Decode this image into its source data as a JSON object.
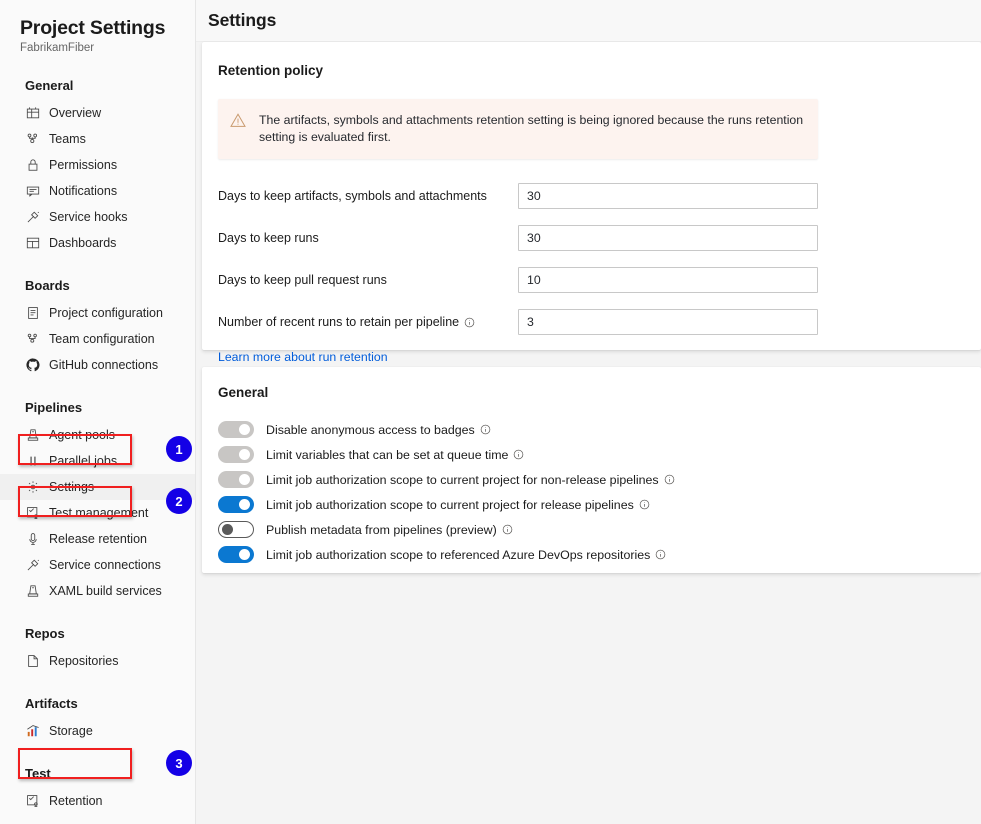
{
  "sidebar": {
    "title": "Project Settings",
    "subtitle": "FabrikamFiber",
    "groups": [
      {
        "header": "General",
        "items": [
          {
            "label": "Overview",
            "icon": "overview-icon"
          },
          {
            "label": "Teams",
            "icon": "teams-icon"
          },
          {
            "label": "Permissions",
            "icon": "lock-icon"
          },
          {
            "label": "Notifications",
            "icon": "notification-icon"
          },
          {
            "label": "Service hooks",
            "icon": "service-hooks-icon"
          },
          {
            "label": "Dashboards",
            "icon": "dashboards-icon"
          }
        ]
      },
      {
        "header": "Boards",
        "items": [
          {
            "label": "Project configuration",
            "icon": "project-config-icon"
          },
          {
            "label": "Team configuration",
            "icon": "team-config-icon"
          },
          {
            "label": "GitHub connections",
            "icon": "github-icon"
          }
        ]
      },
      {
        "header": "Pipelines",
        "items": [
          {
            "label": "Agent pools",
            "icon": "agent-pools-icon"
          },
          {
            "label": "Parallel jobs",
            "icon": "parallel-jobs-icon"
          },
          {
            "label": "Settings",
            "icon": "gear-icon",
            "selected": true,
            "highlighted": true,
            "badge": "1"
          },
          {
            "label": "Test management",
            "icon": "test-management-icon"
          },
          {
            "label": "Release retention",
            "icon": "release-retention-icon",
            "highlighted": true,
            "badge": "2"
          },
          {
            "label": "Service connections",
            "icon": "service-connections-icon"
          },
          {
            "label": "XAML build services",
            "icon": "xaml-build-icon"
          }
        ]
      },
      {
        "header": "Repos",
        "items": [
          {
            "label": "Repositories",
            "icon": "repositories-icon"
          }
        ]
      },
      {
        "header": "Artifacts",
        "items": [
          {
            "label": "Storage",
            "icon": "storage-icon"
          }
        ]
      },
      {
        "header": "Test",
        "items": [
          {
            "label": "Retention",
            "icon": "retention-icon",
            "highlighted": true,
            "badge": "3"
          }
        ]
      }
    ]
  },
  "header": {
    "title": "Settings"
  },
  "retention": {
    "card_title": "Retention policy",
    "warning": "The artifacts, symbols and attachments retention setting is being ignored because the runs retention setting is evaluated first.",
    "warning_icon": "warning-triangle-icon",
    "fields": [
      {
        "label": "Days to keep artifacts, symbols and attachments",
        "value": "30",
        "info": false
      },
      {
        "label": "Days to keep runs",
        "value": "30",
        "info": false
      },
      {
        "label": "Days to keep pull request runs",
        "value": "10",
        "info": false
      },
      {
        "label": "Number of recent runs to retain per pipeline",
        "value": "3",
        "info": true
      }
    ],
    "learn_more": "Learn more about run retention"
  },
  "general": {
    "card_title": "General",
    "toggles": [
      {
        "label": "Disable anonymous access to badges",
        "state": "off",
        "info": true
      },
      {
        "label": "Limit variables that can be set at queue time",
        "state": "off",
        "info": true
      },
      {
        "label": "Limit job authorization scope to current project for non-release pipelines",
        "state": "off",
        "info": true
      },
      {
        "label": "Limit job authorization scope to current project for release pipelines",
        "state": "on",
        "info": true
      },
      {
        "label": "Publish metadata from pipelines (preview)",
        "state": "offdark",
        "info": true
      },
      {
        "label": "Limit job authorization scope to referenced Azure DevOps repositories",
        "state": "on",
        "info": true
      }
    ]
  },
  "colors": {
    "accent": "#0b78d1",
    "badge": "#1400e6",
    "highlight_box": "#f01f1f",
    "link": "#015cda",
    "warning_bg": "#fdf3ef"
  }
}
